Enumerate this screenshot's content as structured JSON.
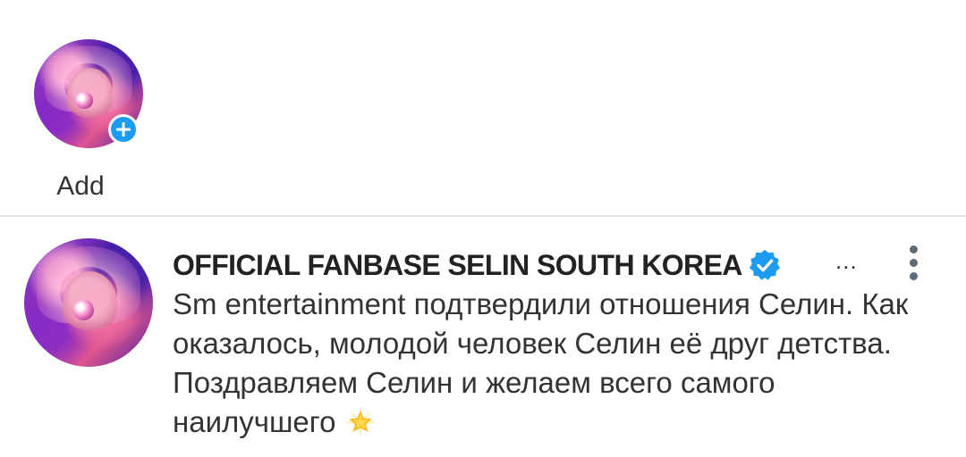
{
  "stories": {
    "add_label": "Add"
  },
  "post": {
    "author": "OFFICIAL FANBASE SELIN SOUTH KOREA",
    "ellipsis": "...",
    "text": "Sm entertainment подтвердили отношения Селин. Как оказалось, молодой человек Селин её друг детства. Поздравляем Селин и желаем всего самого наилучшего",
    "emoji": "glowing-star-icon"
  },
  "colors": {
    "badge_blue": "#1d9bf0",
    "text": "#333333",
    "divider": "#e6e6e6",
    "more_icon": "#5b6b78"
  }
}
